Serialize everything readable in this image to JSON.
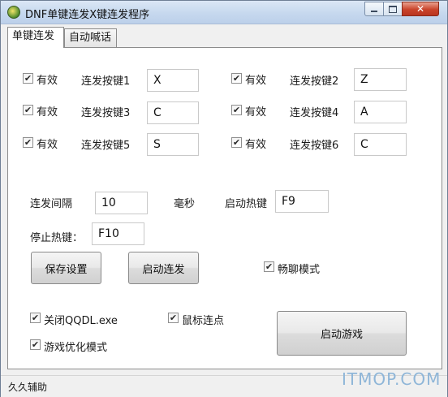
{
  "window": {
    "title": "DNF单键连发X键连发程序"
  },
  "tabs": [
    {
      "label": "单键连发"
    },
    {
      "label": "自动喊话"
    }
  ],
  "keys": [
    {
      "enabled_label": "有效",
      "label": "连发按键1",
      "value": "X"
    },
    {
      "enabled_label": "有效",
      "label": "连发按键2",
      "value": "Z"
    },
    {
      "enabled_label": "有效",
      "label": "连发按键3",
      "value": "C"
    },
    {
      "enabled_label": "有效",
      "label": "连发按键4",
      "value": "A"
    },
    {
      "enabled_label": "有效",
      "label": "连发按键5",
      "value": "S"
    },
    {
      "enabled_label": "有效",
      "label": "连发按键6",
      "value": "C"
    }
  ],
  "settings": {
    "interval_label": "连发间隔",
    "interval_value": "10",
    "interval_unit": "毫秒",
    "start_hotkey_label": "启动热键",
    "start_hotkey_value": "F9",
    "stop_hotkey_label": "停止热键：",
    "stop_hotkey_value": "F10"
  },
  "buttons": {
    "save": "保存设置",
    "start_burst": "启动连发",
    "start_game": "启动游戏"
  },
  "options": {
    "chat_mode": "畅聊模式",
    "close_qqdl": "关闭QQDL.exe",
    "mouse_click": "鼠标连点",
    "game_optimize": "游戏优化模式"
  },
  "status": {
    "text": "久久辅助"
  },
  "watermark": {
    "text": "ITMOP.COM"
  }
}
